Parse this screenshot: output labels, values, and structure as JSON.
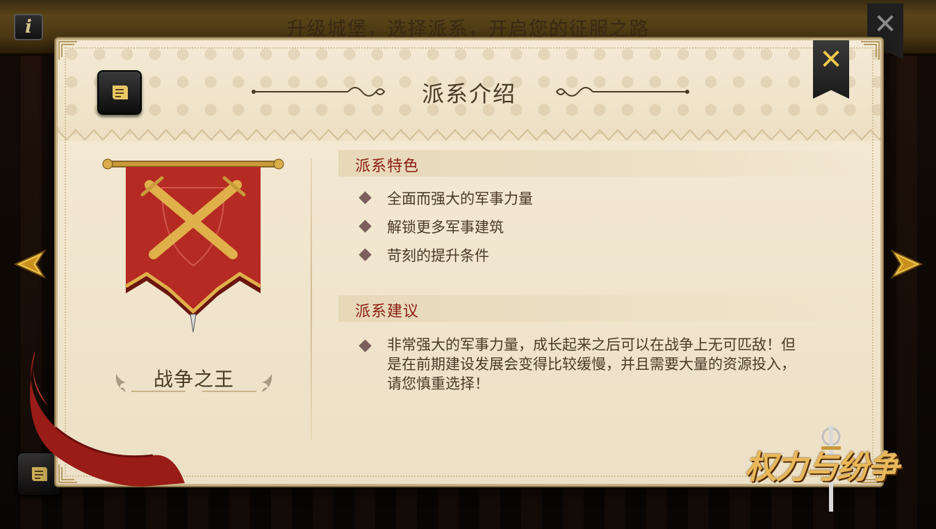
{
  "top_bar": {
    "title": "升级城堡，选择派系，开启您的征服之路",
    "info_label": "i",
    "close_label": "✕"
  },
  "modal": {
    "title": "派系介绍",
    "close_label": "✕"
  },
  "faction": {
    "name": "战争之王",
    "banner_color": "#b52a22",
    "emblem_color": "#e0b04a"
  },
  "traits_section": {
    "title": "派系特色",
    "items": [
      "全面而强大的军事力量",
      "解锁更多军事建筑",
      "苛刻的提升条件"
    ]
  },
  "advice_section": {
    "title": "派系建议",
    "text": "非常强大的军事力量，成长起来之后可以在战争上无可匹敌！但是在前期建设发展会变得比较缓慢，并且需要大量的资源投入，请您慎重选择！"
  },
  "logo": {
    "text": "权力与纷争"
  },
  "colors": {
    "accent_gold": "#f2c94c",
    "section_title": "#8a1d12",
    "body_text": "#4a3a26",
    "parchment": "#efe3c8"
  },
  "icons": {
    "info": "info-icon",
    "scroll": "scroll-icon",
    "left_arrow": "arrow-left-icon",
    "right_arrow": "arrow-right-icon",
    "close": "close-icon"
  }
}
